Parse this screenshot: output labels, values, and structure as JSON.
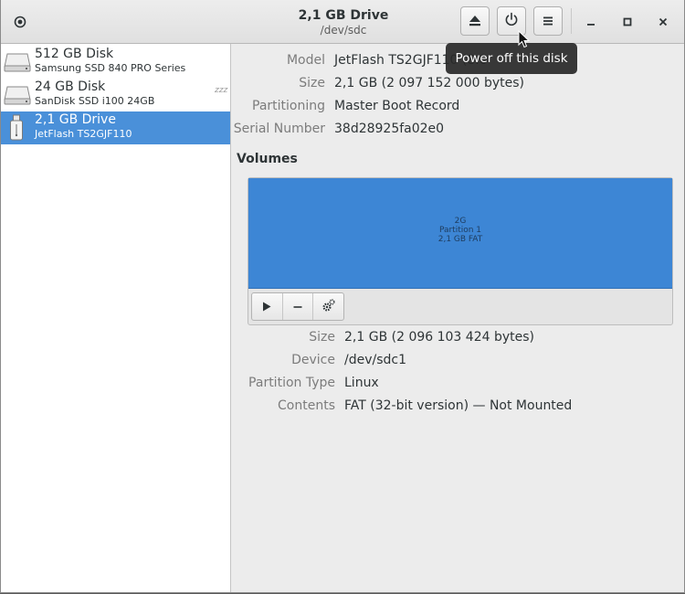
{
  "header": {
    "title": "2,1 GB Drive",
    "subtitle": "/dev/sdc",
    "app_icon": "disks-app-icon",
    "buttons": [
      "eject-icon",
      "power-icon",
      "menu-icon"
    ],
    "window_buttons": [
      "minimize-icon",
      "maximize-icon",
      "close-icon"
    ]
  },
  "tooltip": "Power off this disk",
  "sidebar": {
    "items": [
      {
        "name": "512 GB Disk",
        "model": "Samsung SSD 840 PRO Series",
        "icon": "hard-disk-icon",
        "selected": false
      },
      {
        "name": "24 GB Disk",
        "model": "SanDisk SSD i100 24GB",
        "icon": "hard-disk-icon",
        "selected": false,
        "standby": "zzz"
      },
      {
        "name": "2,1 GB Drive",
        "model": "JetFlash TS2GJF110",
        "icon": "usb-drive-icon",
        "selected": true
      }
    ]
  },
  "drive_info": [
    {
      "label": "Model",
      "value": "JetFlash TS2GJF110 (8.0"
    },
    {
      "label": "Size",
      "value": "2,1 GB (2 097 152 000 bytes)"
    },
    {
      "label": "Partitioning",
      "value": "Master Boot Record"
    },
    {
      "label": "Serial Number",
      "value": "38d28925fa02e0"
    }
  ],
  "volumes": {
    "heading": "Volumes",
    "partition": {
      "line1": "2G",
      "line2": "Partition 1",
      "line3": "2,1 GB FAT"
    },
    "toolbar": [
      "play-icon",
      "minus-icon",
      "gears-icon"
    ],
    "colors": {
      "partition": "#3d86d5",
      "selection": "#4a90d9"
    }
  },
  "volume_info": [
    {
      "label": "Size",
      "value": "2,1 GB (2 096 103 424 bytes)"
    },
    {
      "label": "Device",
      "value": "/dev/sdc1"
    },
    {
      "label": "Partition Type",
      "value": "Linux"
    },
    {
      "label": "Contents",
      "value": "FAT (32-bit version) — Not Mounted"
    }
  ]
}
